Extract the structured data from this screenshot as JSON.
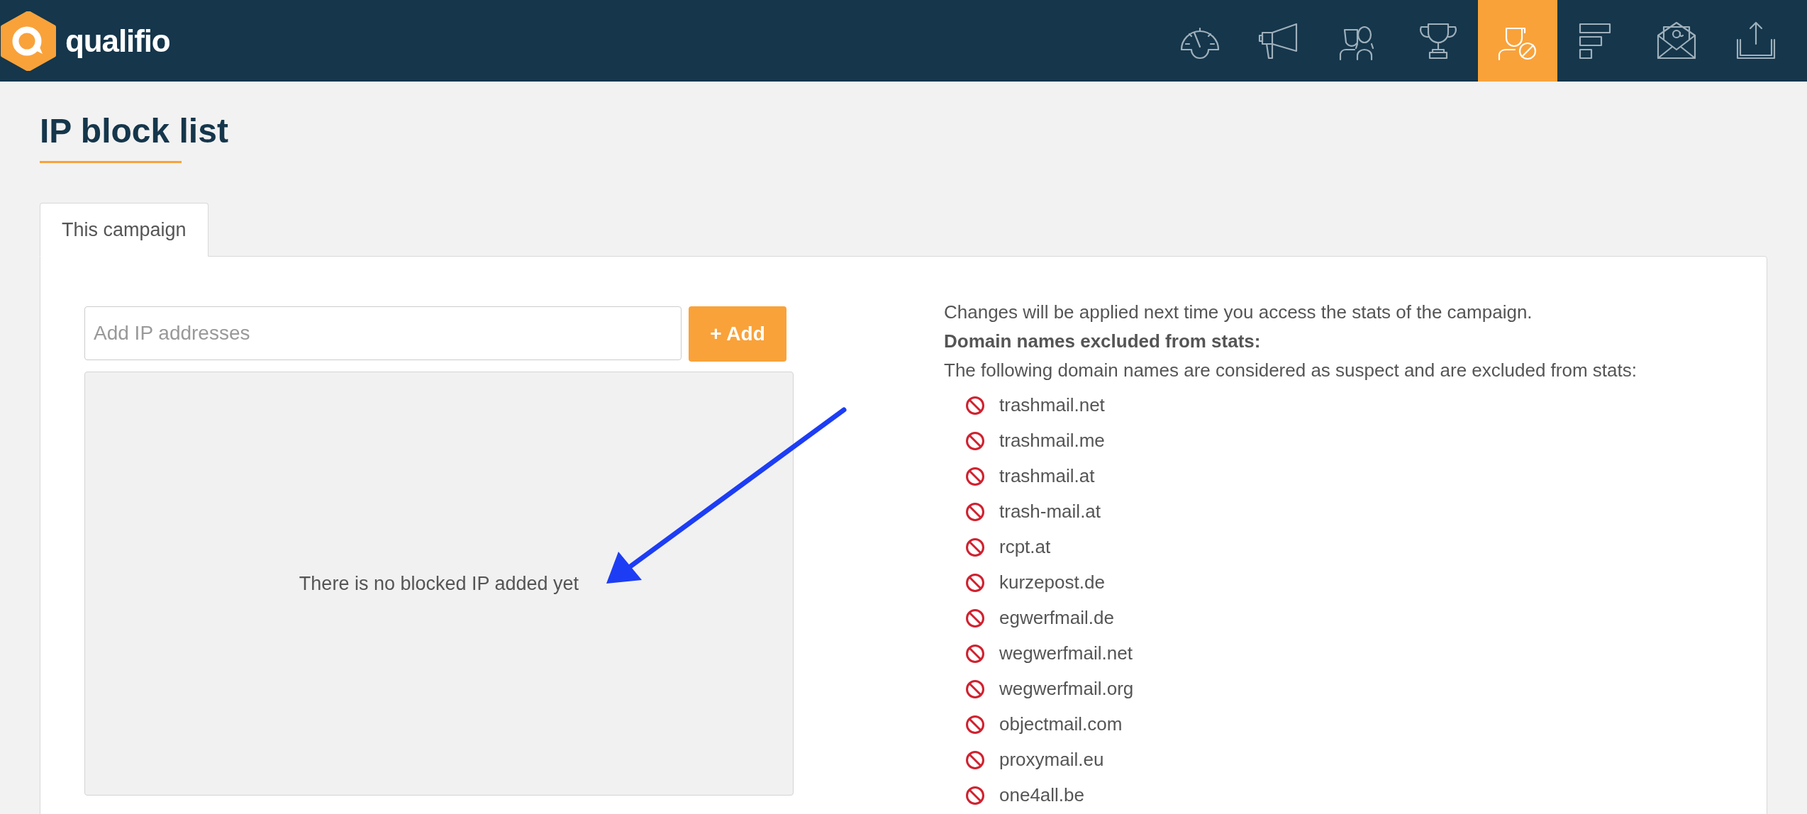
{
  "header": {
    "logo_text": "qualifio",
    "nav": [
      {
        "kind": "gauge",
        "selected": false
      },
      {
        "kind": "megaphone",
        "selected": false
      },
      {
        "kind": "people",
        "selected": false
      },
      {
        "kind": "trophy",
        "selected": false
      },
      {
        "kind": "blocked-user",
        "selected": true
      },
      {
        "kind": "bars",
        "selected": false
      },
      {
        "kind": "mail",
        "selected": false
      },
      {
        "kind": "upload",
        "selected": false
      }
    ]
  },
  "page_title": "IP block list",
  "tabs": [
    {
      "label": "This campaign",
      "selected": true
    }
  ],
  "ip_form": {
    "placeholder": "Add IP addresses",
    "add_button": "+ Add",
    "empty_message": "There is no blocked IP added yet"
  },
  "info": {
    "note": "Changes will be applied next time you access the stats of the campaign.",
    "heading": "Domain names excluded from stats:",
    "description": "The following domain names are considered as suspect and are excluded from stats:",
    "domains": [
      "trashmail.net",
      "trashmail.me",
      "trashmail.at",
      "trash-mail.at",
      "rcpt.at",
      "kurzepost.de",
      "egwerfmail.de",
      "wegwerfmail.net",
      "wegwerfmail.org",
      "objectmail.com",
      "proxymail.eu",
      "one4all.be"
    ]
  }
}
